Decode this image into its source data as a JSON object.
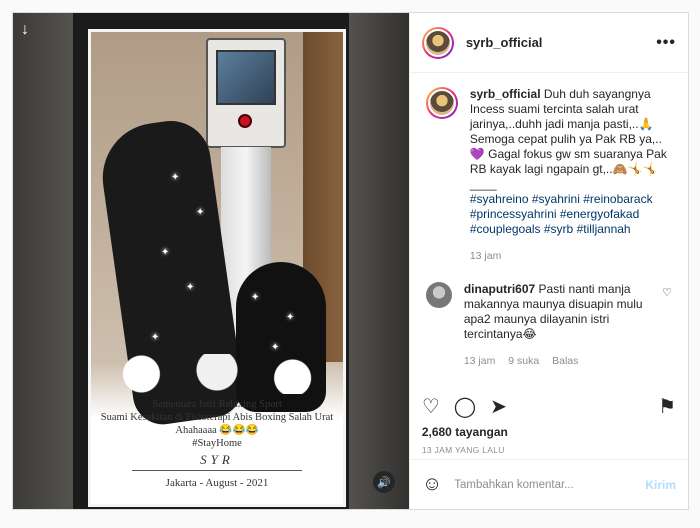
{
  "post": {
    "username": "syrb_official",
    "more_label": "•••",
    "caption_user": "syrb_official",
    "caption_text": "Duh duh sayangnya Incess suami tercinta salah urat jarinya,..duhh jadi manja pasti,..🙏 Semoga cepat pulih ya Pak RB ya,..💜 Gagal fokus gw sm suaranya Pak RB kayak lagi ngapain gt,..🙈🤸🤸",
    "caption_separator": "____",
    "hashtags": "#syahreino #syahrini #reinobarack #princessyahrini #energyofakad #couplegoals #syrb #tilljannah",
    "caption_time": "13 jam",
    "views": "2,680 tayangan",
    "timestamp": "13 JAM YANG LALU"
  },
  "comments": [
    {
      "user": "dinaputri607",
      "text": "Pasti nanti manja makannya maunya disuapin mulu apa2 maunya dilayanin istri tercintanya😂",
      "time": "13 jam",
      "likes": "9 suka",
      "reply": "Balas"
    }
  ],
  "media": {
    "overlay_line1": "Sementara Istri Relaxing Sport",
    "overlay_line2": "Suami Kesakitan di Fisioterapi Abis Boxing Salah Urat",
    "overlay_line3": "Ahahaaaa 😂😂😂",
    "overlay_tag": "#StayHome",
    "overlay_sig": "SYR",
    "overlay_date": "Jakarta - August - 2021"
  },
  "icons": {
    "download": "↓",
    "mute": "🔊",
    "heart": "♡",
    "comment": "◯",
    "share": "➤",
    "save": "⚑",
    "heart_small": "♡",
    "emoji": "☺"
  },
  "add_comment": {
    "placeholder": "Tambahkan komentar...",
    "post_label": "Kirim"
  }
}
